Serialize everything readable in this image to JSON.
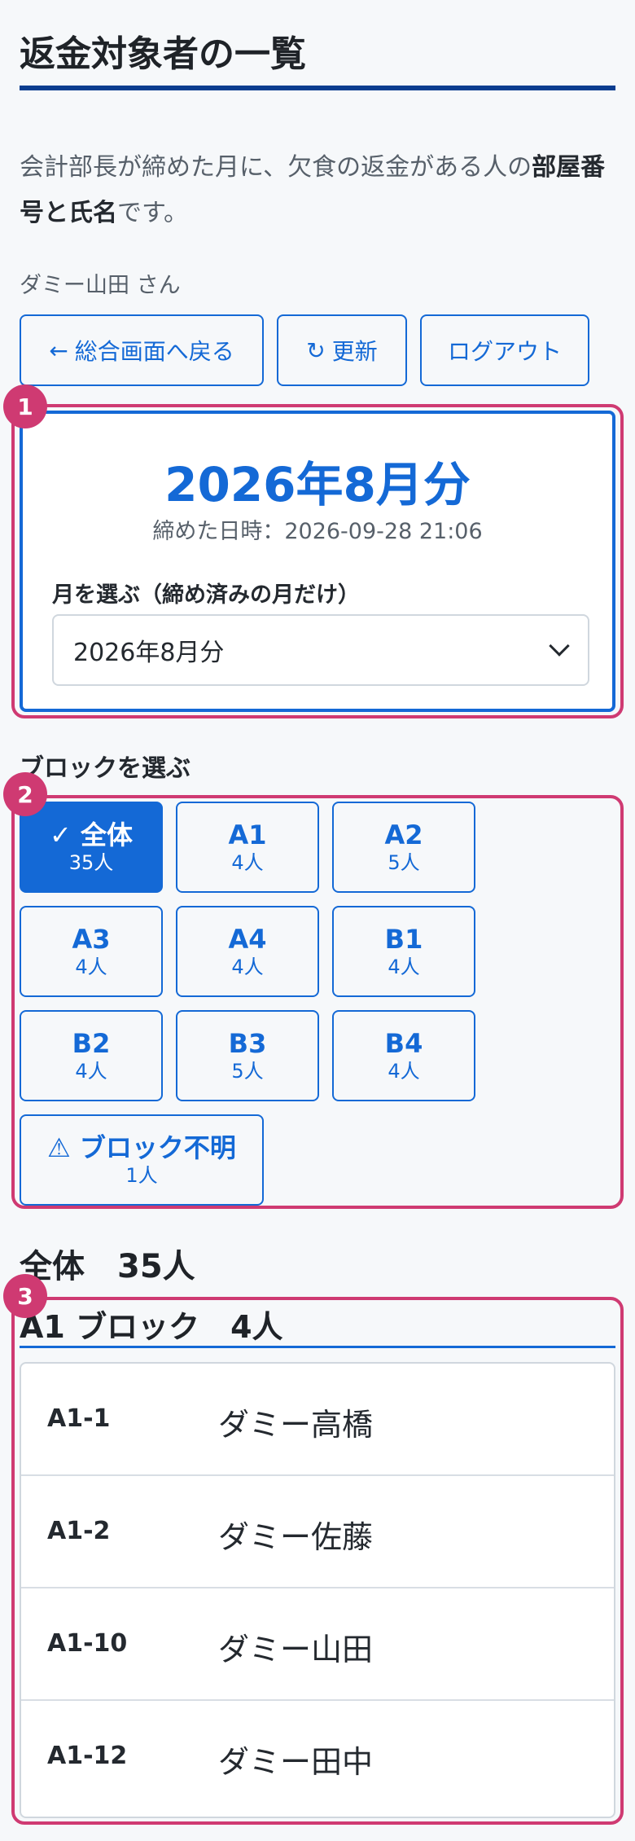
{
  "page": {
    "title": "返金対象者の一覧",
    "intro_prefix": "会計部長が締めた月に、欠食の返金がある人の",
    "intro_bold": "部屋番号と氏名",
    "intro_suffix": "です。",
    "user_label": "ダミー山田 さん"
  },
  "actions": {
    "back": {
      "icon": "arrow-left-icon",
      "glyph": "←",
      "label": "総合画面へ戻る"
    },
    "refresh": {
      "icon": "refresh-icon",
      "glyph": "↻",
      "label": "更新"
    },
    "logout": {
      "label": "ログアウト"
    }
  },
  "badges": [
    "1",
    "2",
    "3"
  ],
  "month_card": {
    "month_title": "2026年8月分",
    "closed_at": "締めた日時：2026-09-28 21:06",
    "select_label": "月を選ぶ（締め済みの月だけ）",
    "selected_month": "2026年8月分"
  },
  "block_filter": {
    "label": "ブロックを選ぶ",
    "blocks": [
      {
        "name": "全体",
        "count": "35人",
        "active": true,
        "icon": "check-icon",
        "glyph": "✓"
      },
      {
        "name": "A1",
        "count": "4人"
      },
      {
        "name": "A2",
        "count": "5人"
      },
      {
        "name": "A3",
        "count": "4人"
      },
      {
        "name": "A4",
        "count": "4人"
      },
      {
        "name": "B1",
        "count": "4人"
      },
      {
        "name": "B2",
        "count": "4人"
      },
      {
        "name": "B3",
        "count": "5人"
      },
      {
        "name": "B4",
        "count": "4人"
      },
      {
        "name": "ブロック不明",
        "count": "1人",
        "icon": "warning-icon",
        "glyph": "⚠"
      }
    ]
  },
  "results": {
    "total_heading": "全体　35人",
    "group_heading": "A1 ブロック　4人",
    "rows": [
      {
        "room": "A1-1",
        "name": "ダミー高橋"
      },
      {
        "room": "A1-2",
        "name": "ダミー佐藤"
      },
      {
        "room": "A1-10",
        "name": "ダミー山田"
      },
      {
        "room": "A1-12",
        "name": "ダミー田中"
      }
    ]
  },
  "colors": {
    "accent": "#1469d6",
    "annotation": "#cf3a72",
    "title_rule": "#0a3d8f"
  }
}
